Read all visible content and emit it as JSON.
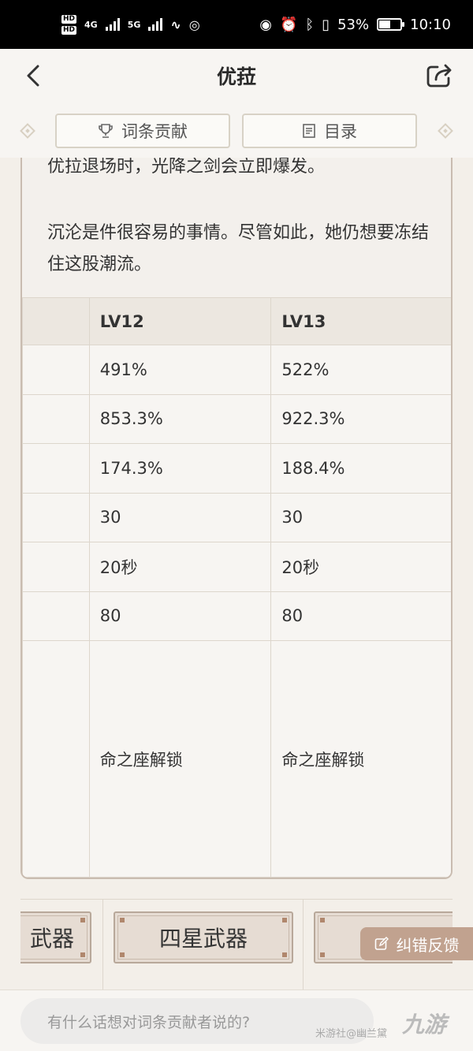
{
  "status_bar": {
    "network_left": [
      "HD",
      "HD"
    ],
    "network_4g": "4G",
    "network_5g": "5G",
    "battery": "53%",
    "time": "10:10"
  },
  "header": {
    "title": "优菈",
    "back_icon": "chevron-left-icon",
    "share_icon": "share-icon"
  },
  "tabs": [
    {
      "label": "词条贡献",
      "icon": "trophy-icon"
    },
    {
      "label": "目录",
      "icon": "list-icon"
    }
  ],
  "content": {
    "line_1": "优拉退场时，光降之剑会立即爆发。",
    "para_2": "沉沦是件很容易的事情。尽管如此，她仍想要冻结住这股潮流。"
  },
  "table": {
    "headers": [
      "",
      "LV12",
      "LV13"
    ],
    "rows": [
      [
        "",
        "491%",
        "522%"
      ],
      [
        "",
        "853.3%",
        "922.3%"
      ],
      [
        "",
        "174.3%",
        "188.4%"
      ],
      [
        "",
        "30",
        "30"
      ],
      [
        "",
        "20秒",
        "20秒"
      ],
      [
        "",
        "80",
        "80"
      ],
      [
        "",
        "命之座解锁",
        "命之座解锁"
      ]
    ]
  },
  "bottom_buttons": [
    "武器",
    "四星武器",
    ""
  ],
  "feedback": {
    "label": "纠错反馈",
    "icon": "edit-icon"
  },
  "comment": {
    "placeholder": "有什么话想对词条贡献者说的?",
    "watermark": "米游社@幽兰黛",
    "logo": "九游"
  },
  "colors": {
    "accent": "#c1a28f",
    "card_border": "#c9bcb0",
    "header_cell": "#ece7e0"
  }
}
